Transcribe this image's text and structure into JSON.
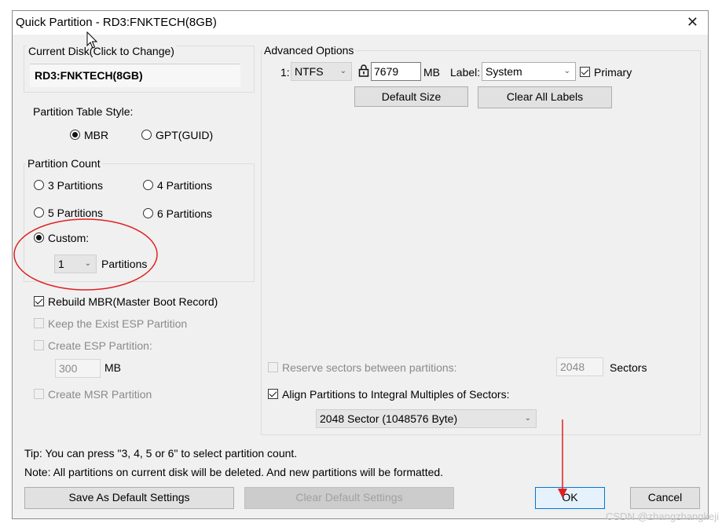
{
  "window": {
    "title": "Quick Partition - RD3:FNKTECH(8GB)",
    "close_glyph": "✕"
  },
  "current_disk": {
    "label": "Current Disk(Click to Change)",
    "value": "RD3:FNKTECH(8GB)"
  },
  "partition_table_style": {
    "label": "Partition Table Style:",
    "options": [
      {
        "label": "MBR",
        "selected": true
      },
      {
        "label": "GPT(GUID)",
        "selected": false
      }
    ]
  },
  "partition_count": {
    "label": "Partition Count",
    "options": [
      {
        "label": "3 Partitions",
        "selected": false
      },
      {
        "label": "4 Partitions",
        "selected": false
      },
      {
        "label": "5 Partitions",
        "selected": false
      },
      {
        "label": "6 Partitions",
        "selected": false
      },
      {
        "label": "Custom:",
        "selected": true
      }
    ],
    "custom_value": "1",
    "custom_suffix": "Partitions"
  },
  "left_options": {
    "rebuild_mbr": {
      "label": "Rebuild MBR(Master Boot Record)",
      "checked": true,
      "enabled": true
    },
    "keep_esp": {
      "label": "Keep the Exist ESP Partition",
      "checked": false,
      "enabled": false
    },
    "create_esp": {
      "label": "Create ESP Partition:",
      "checked": false,
      "enabled": false
    },
    "esp_size": {
      "value": "300",
      "unit": "MB"
    },
    "create_msr": {
      "label": "Create MSR Partition",
      "checked": false,
      "enabled": false
    }
  },
  "advanced": {
    "label": "Advanced Options",
    "row": {
      "index": "1:",
      "fs": "NTFS",
      "size": "7679",
      "size_unit": "MB",
      "label_caption": "Label:",
      "label_value": "System",
      "primary_label": "Primary",
      "primary_checked": true
    },
    "default_size_button": "Default Size",
    "clear_labels_button": "Clear All Labels",
    "reserve": {
      "label": "Reserve sectors between partitions:",
      "value": "2048",
      "unit": "Sectors",
      "checked": false
    },
    "align": {
      "label": "Align Partitions to Integral Multiples of Sectors:",
      "checked": true,
      "value": "2048 Sector (1048576 Byte)"
    }
  },
  "tips": {
    "tip": "Tip:  You can press \"3, 4, 5 or 6\" to select partition count.",
    "note": "Note: All partitions on current disk will be deleted. And new partitions will be formatted."
  },
  "buttons": {
    "save_default": "Save As Default Settings",
    "clear_default": "Clear Default Settings",
    "ok": "OK",
    "cancel": "Cancel"
  },
  "watermark": "CSDN @zhangzhangkeji",
  "colors": {
    "annotation_red": "#e02020",
    "dialog_bg": "#f0f0f0",
    "default_button_border": "#0078d7"
  }
}
